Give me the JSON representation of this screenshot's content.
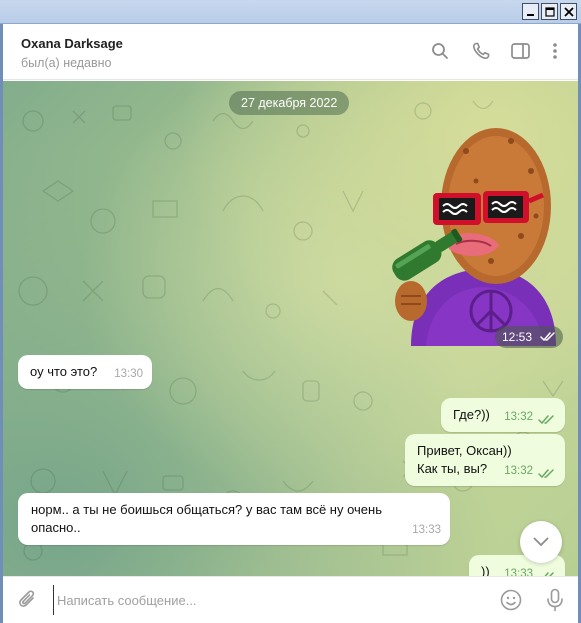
{
  "window": {
    "controls": [
      "minimize-icon",
      "maximize-icon",
      "close-icon"
    ]
  },
  "header": {
    "name": "Oxana Darksage",
    "status": "был(а) недавно",
    "icons": [
      "search-icon",
      "phone-icon",
      "sidebar-icon",
      "more-vertical-icon"
    ]
  },
  "chat": {
    "date_label": "27 декабря 2022",
    "sticker": {
      "time": "12:53",
      "icon": "double-check-icon"
    },
    "messages": [
      {
        "direction": "in",
        "text": "оу что это?",
        "time": "13:30"
      },
      {
        "direction": "out",
        "text": "Где?))",
        "time": "13:32",
        "read": true
      },
      {
        "direction": "out",
        "lines": [
          "Привет, Оксан))",
          "Как ты, вы?"
        ],
        "time": "13:32",
        "read": true
      },
      {
        "direction": "in",
        "lines": [
          "норм.. а ты не боишься общаться? у вас там всё ну очень",
          "опасно.."
        ],
        "time": "13:33"
      },
      {
        "direction": "out",
        "text": "))",
        "time": "13:33",
        "read": true
      }
    ]
  },
  "composer": {
    "placeholder": "Написать сообщение...",
    "value": "",
    "icons": [
      "attach-icon",
      "emoji-icon",
      "microphone-icon"
    ]
  },
  "colors": {
    "outgoing_bubble": "#effdde",
    "incoming_bubble": "#ffffff",
    "check_green": "#6aa864"
  }
}
